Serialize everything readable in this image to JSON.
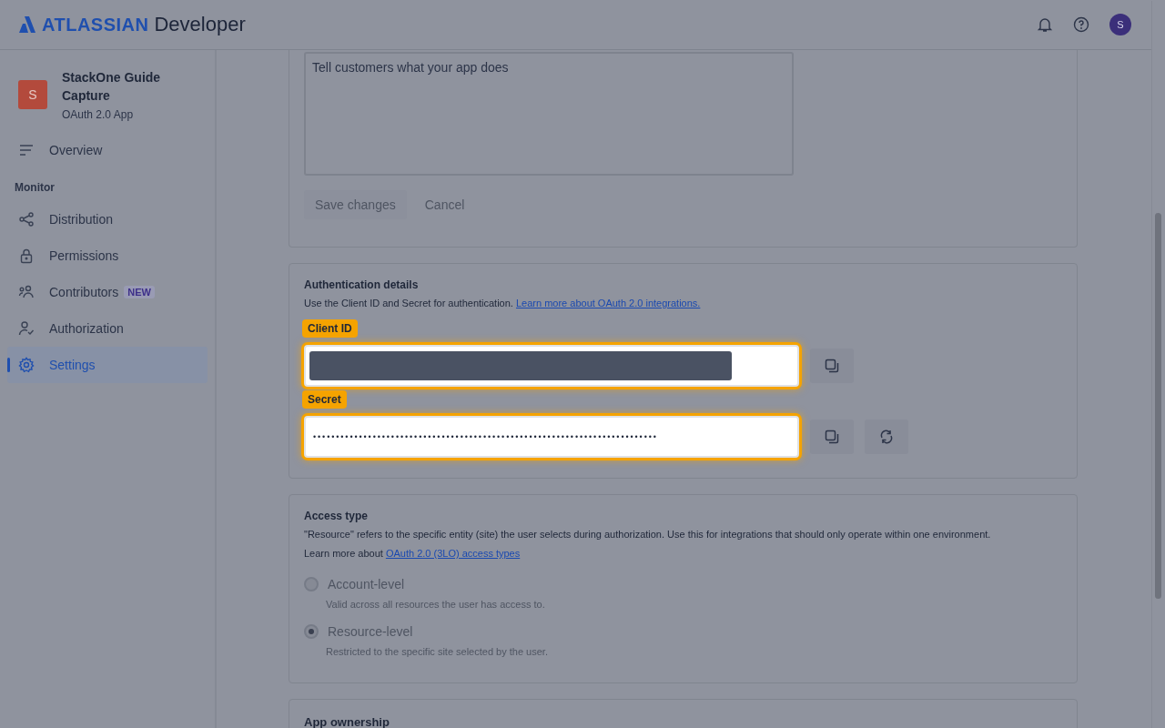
{
  "header": {
    "brand": "ATLASSIAN",
    "product": "Developer",
    "avatar": "S"
  },
  "sidebar": {
    "app": {
      "initial": "S",
      "name": "StackOne Guide Capture",
      "type": "OAuth 2.0 App"
    },
    "items": [
      {
        "kind": "link",
        "label": "Overview",
        "selected": false
      },
      {
        "kind": "section",
        "label": "Monitor"
      },
      {
        "kind": "link",
        "label": "Distribution",
        "selected": false
      },
      {
        "kind": "link",
        "label": "Permissions",
        "selected": false
      },
      {
        "kind": "link",
        "label": "Contributors",
        "selected": false,
        "badge": "NEW"
      },
      {
        "kind": "link",
        "label": "Authorization",
        "selected": false
      },
      {
        "kind": "link",
        "label": "Settings",
        "selected": true
      }
    ]
  },
  "description_card": {
    "placeholder": "Tell customers what your app does",
    "buttons": [
      {
        "label": "Save changes",
        "disabled": true
      },
      {
        "label": "Cancel",
        "disabled": true
      }
    ]
  },
  "auth_card": {
    "title": "Authentication details",
    "text": "Use the Client ID and Secret for authentication.",
    "link": "Learn more about OAuth 2.0 integrations.",
    "fields": [
      {
        "kind": "id",
        "tag": "Client ID",
        "redacted": true
      },
      {
        "kind": "secret",
        "tag": "Secret",
        "redacted": false,
        "value": "•••••••••••••••••••••••••••••••••••••••••••••••••••••••••••••••••••••••••••"
      }
    ]
  },
  "access_card": {
    "title": "Access type",
    "text": "\"Resource\" refers to the specific entity (site) the user selects during authorization. Use this for integrations that should only operate within one environment.",
    "lead": "Learn more about",
    "link": "OAuth 2.0 (3LO) access types",
    "options": [
      {
        "label": "Account-level",
        "hint": "Valid across all resources the user has access to.",
        "selected": false,
        "disabled": true
      },
      {
        "label": "Resource-level",
        "hint": "Restricted to the specific site selected by the user.",
        "selected": true,
        "disabled": true
      }
    ]
  },
  "ownership_card": {
    "title": "App ownership"
  }
}
